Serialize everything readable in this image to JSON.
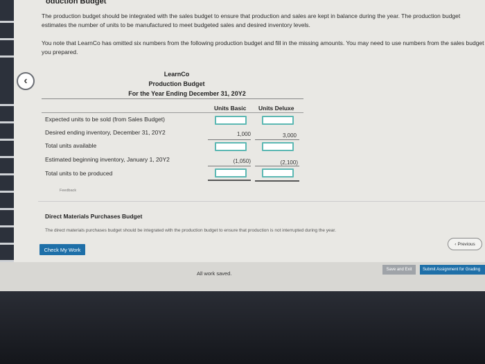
{
  "header": {
    "section_title": "oduction Budget"
  },
  "intro": {
    "paragraph_1": "The production budget should be integrated with the sales budget to ensure that production and sales are kept in balance during the year. The production budget estimates the number of units to be manufactured to meet budgeted sales and desired inventory levels.",
    "paragraph_2": "You note that LearnCo has omitted six numbers from the following production budget and fill in the missing amounts. You may need to use numbers from the sales budget you prepared."
  },
  "budget": {
    "company": "LearnCo",
    "title": "Production Budget",
    "period": "For the Year Ending December 31, 20Y2",
    "columns": [
      "Units Basic",
      "Units Deluxe"
    ],
    "rows": [
      {
        "label": "Expected units to be sold (from Sales Budget)",
        "basic": "",
        "deluxe": ""
      },
      {
        "label": "Desired ending inventory, December 31, 20Y2",
        "basic": "1,000",
        "deluxe": "3,000"
      },
      {
        "label": "Total units available",
        "basic": "",
        "deluxe": ""
      },
      {
        "label": "Estimated beginning inventory, January 1, 20Y2",
        "basic": "(1,050)",
        "deluxe": "(2,100)"
      },
      {
        "label": "Total units to be produced",
        "basic": "",
        "deluxe": ""
      }
    ]
  },
  "feedback_label": "Feedback",
  "direct_materials": {
    "title": "Direct Materials Purchases Budget",
    "text": "The direct materials purchases budget should be integrated with the production budget to ensure that production is not interrupted during the year."
  },
  "buttons": {
    "check_my_work": "Check My Work",
    "previous": "Previous",
    "save_and_exit": "Save and Exit",
    "submit": "Submit Assignment for Grading"
  },
  "status": {
    "saved": "All work saved."
  }
}
